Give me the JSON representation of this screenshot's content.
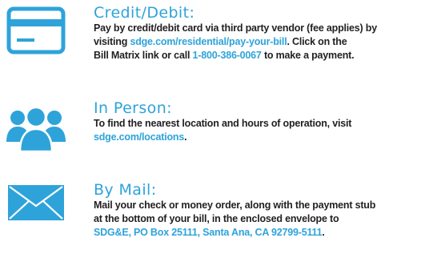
{
  "colors": {
    "accent": "#2EA3DA",
    "text": "#231F20",
    "background": "#FFFFFF"
  },
  "credit_debit": {
    "icon": "credit-card-icon",
    "heading": "Credit/Debit:",
    "line1": "Pay by credit/debit card via third party vendor (fee applies) by",
    "pre_link": "visiting ",
    "link": "sdge.com/residential/pay-your-bill",
    "post_link": ". Click on the",
    "line3_pre": "Bill Matrix link or call ",
    "phone": "1-800-386-0067",
    "line3_post": " to make a payment."
  },
  "in_person": {
    "icon": "people-icon",
    "heading": "In Person:",
    "line1": "To find the nearest location and hours of operation, visit",
    "link": "sdge.com/locations",
    "post_link": "."
  },
  "by_mail": {
    "icon": "envelope-icon",
    "heading": "By Mail:",
    "line1": "Mail your check or money order, along with the payment stub",
    "line2": "at the bottom of your bill, in the enclosed envelope to",
    "address": "SDG&E, PO Box 25111, Santa Ana, CA 92799-5111",
    "post_address": "."
  }
}
